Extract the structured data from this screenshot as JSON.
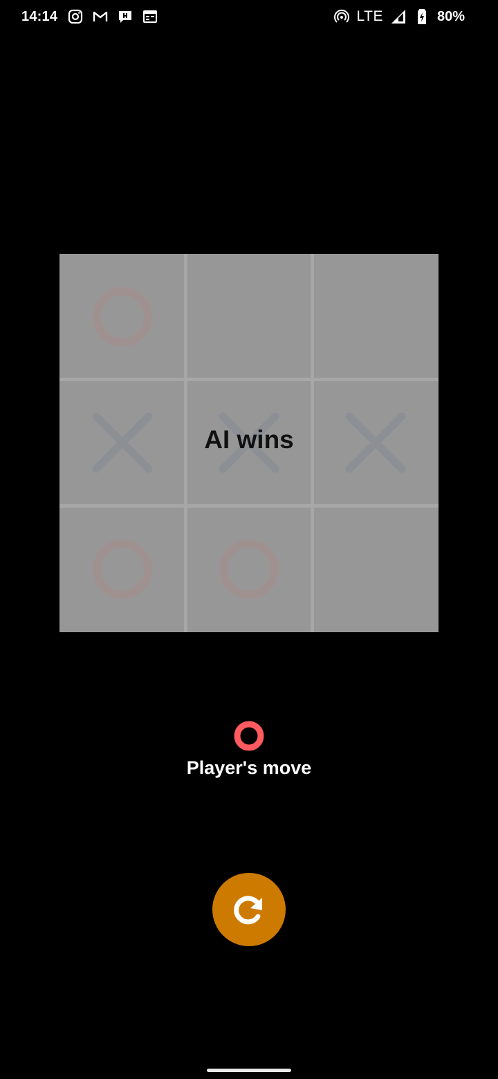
{
  "status_bar": {
    "time": "14:14",
    "left_icons": [
      "instagram-icon",
      "gmail-icon",
      "chat-icon",
      "calendar-icon"
    ],
    "right_icons": [
      "hotspot-icon",
      "signal-icon",
      "battery-charging-icon"
    ],
    "network": "LTE",
    "battery": "80%"
  },
  "board": {
    "cells": [
      "O",
      "",
      "",
      "X",
      "X",
      "X",
      "O",
      "O",
      ""
    ],
    "result": "AI wins",
    "colors": {
      "board_bg": "#979797",
      "grid_line": "#a7a7a7",
      "o_mark": "#a09191",
      "x_mark": "#8c8f94"
    }
  },
  "turn": {
    "icon": "o-mark-icon",
    "label": "Player's move",
    "color": "#ff5a5f"
  },
  "restart": {
    "icon": "refresh-icon",
    "color": "#cc7a00"
  }
}
